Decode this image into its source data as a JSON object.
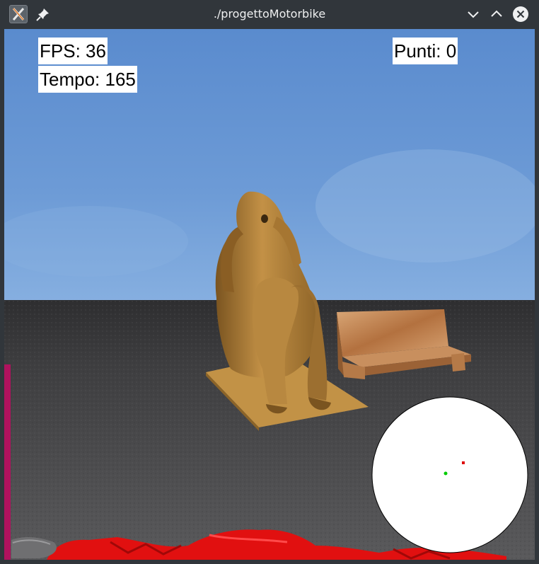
{
  "window": {
    "title": "./progettoMotorbike",
    "buttons": [
      "minimize",
      "maximize",
      "close"
    ]
  },
  "hud": {
    "fps": "FPS: 36",
    "time": "Tempo: 165",
    "score": "Punti: 0"
  },
  "minimap": {
    "player_dot_color": "#00cc00",
    "target_dot_color": "#dd0000"
  },
  "colors": {
    "sky": "#5f8fcf",
    "ground": "#4a4a4c",
    "statue": "#b5823e",
    "bench": "#c48a5a",
    "bike": "#e31010",
    "side_bar": "#b0125e"
  },
  "icons": {
    "app": "x-logo-icon",
    "pin": "pin-icon",
    "minimize": "chevron-down-icon",
    "maximize": "chevron-up-icon",
    "close": "close-circle-icon"
  }
}
